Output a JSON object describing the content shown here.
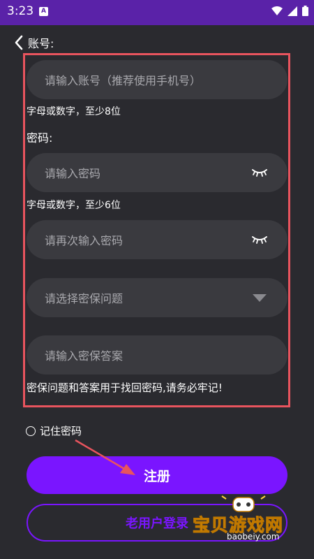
{
  "status_bar": {
    "time": "3:23",
    "badge": "A",
    "accent": "#5a22a8"
  },
  "header": {
    "back_icon": "chevron-left-icon",
    "account_label": "账号:"
  },
  "form": {
    "account_placeholder": "请输入账号（推荐使用手机号）",
    "account_hint": "字母或数字，至少8位",
    "password_label": "密码:",
    "password_placeholder": "请输入密码",
    "password_hint": "字母或数字，至少6位",
    "confirm_placeholder": "请再次输入密码",
    "question_placeholder": "请选择密保问题",
    "answer_placeholder": "请输入密保答案",
    "security_note": "密保问题和答案用于找回密码,请务必牢记!"
  },
  "remember": {
    "label": "记住密码",
    "checked": false
  },
  "buttons": {
    "register_label": "注册",
    "old_user_label": "老用户登录"
  },
  "watermark": {
    "text": "宝贝游戏网",
    "url": "baobeiy.com"
  },
  "colors": {
    "background": "#2a2a2f",
    "accent": "#7a15ff",
    "highlight": "#e8545e",
    "field": "#3a3a3f"
  }
}
